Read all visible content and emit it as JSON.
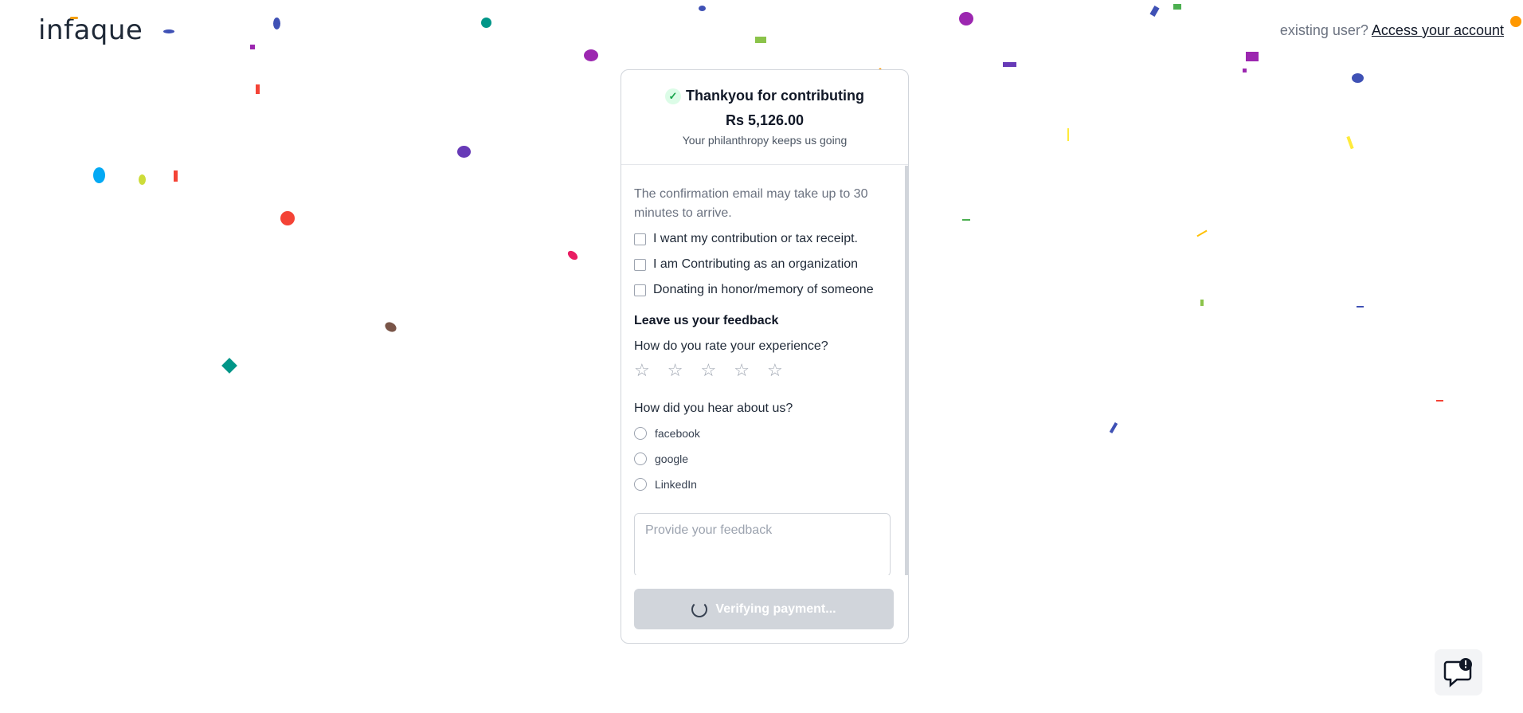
{
  "header": {
    "logo": "infaque",
    "existing_user": "existing user?",
    "access_account": "Access your account"
  },
  "card": {
    "thanks_title": "Thankyou for contributing",
    "amount": "Rs 5,126.00",
    "subtitle": "Your philanthropy keeps us going",
    "note": "The confirmation email may take up to 30 minutes to arrive.",
    "checkboxes": [
      "I want my contribution or tax receipt.",
      "I am Contributing as an organization",
      "Donating in honor/memory of someone"
    ],
    "feedback_title": "Leave us your feedback",
    "rate_question": "How do you rate your experience?",
    "stars": 5,
    "hear_question": "How did you hear about us?",
    "sources": [
      "facebook",
      "google",
      "LinkedIn"
    ],
    "feedback_placeholder": "Provide your feedback",
    "verify_button": "Verifying payment..."
  },
  "colors": {
    "button_disabled": "#d1d5db",
    "check_green": "#16a34a",
    "logo_accent": "#f59e0b"
  },
  "icons": {
    "success": "check-icon",
    "spinner": "spinner-icon",
    "help": "help-chat-icon"
  }
}
